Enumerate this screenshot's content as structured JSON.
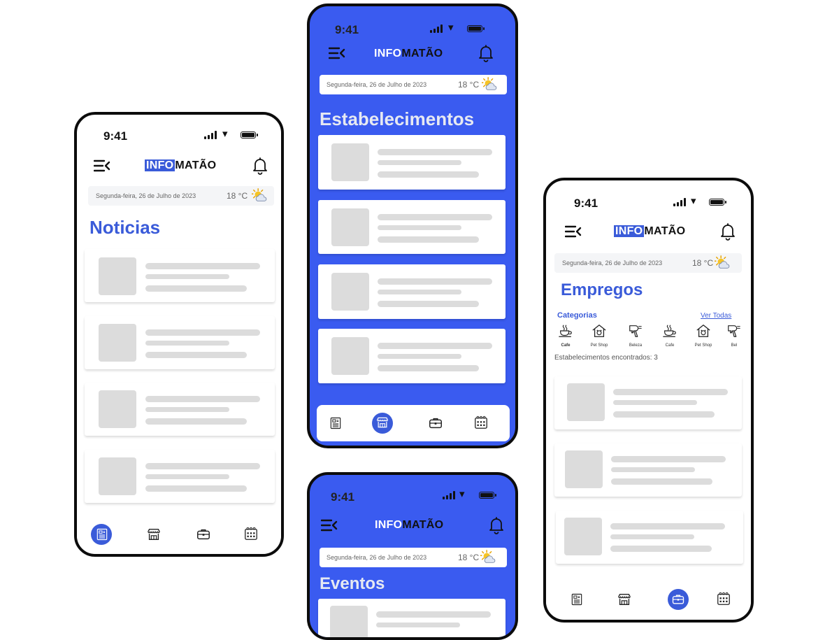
{
  "status": {
    "time": "9:41"
  },
  "logo": {
    "part1": "INFO",
    "part2": "MATÃO"
  },
  "date_bar": {
    "date": "Segunda-feira, 26 de Julho de 2023",
    "temperature": "18 °C"
  },
  "screens": {
    "noticias": {
      "title": "Noticias",
      "active_tab": "noticias"
    },
    "estabelecimentos": {
      "title": "Estabelecimentos",
      "active_tab": "estabelecimentos"
    },
    "eventos": {
      "title": "Eventos"
    },
    "empregos": {
      "title": "Empregos",
      "active_tab": "empregos",
      "categories_label": "Categorias",
      "see_all": "Ver Todas",
      "categories": [
        {
          "label": "Cafe",
          "icon": "coffee-icon"
        },
        {
          "label": "Pet Shop",
          "icon": "pet-house-icon"
        },
        {
          "label": "Beleza",
          "icon": "hair-dryer-icon"
        },
        {
          "label": "Cafe",
          "icon": "coffee-icon"
        },
        {
          "label": "Pet Shop",
          "icon": "pet-house-icon"
        },
        {
          "label": "Bel",
          "icon": "hair-dryer-icon"
        }
      ],
      "found_text": "Estabelecimentos encontrados: 3"
    }
  },
  "nav_tabs": [
    {
      "id": "noticias",
      "icon": "newspaper-icon"
    },
    {
      "id": "estabelecimentos",
      "icon": "storefront-icon"
    },
    {
      "id": "empregos",
      "icon": "briefcase-icon"
    },
    {
      "id": "eventos",
      "icon": "calendar-icon"
    }
  ],
  "colors": {
    "primary": "#3a5bd9",
    "skeleton": "#dcdcdc",
    "white": "#ffffff"
  }
}
